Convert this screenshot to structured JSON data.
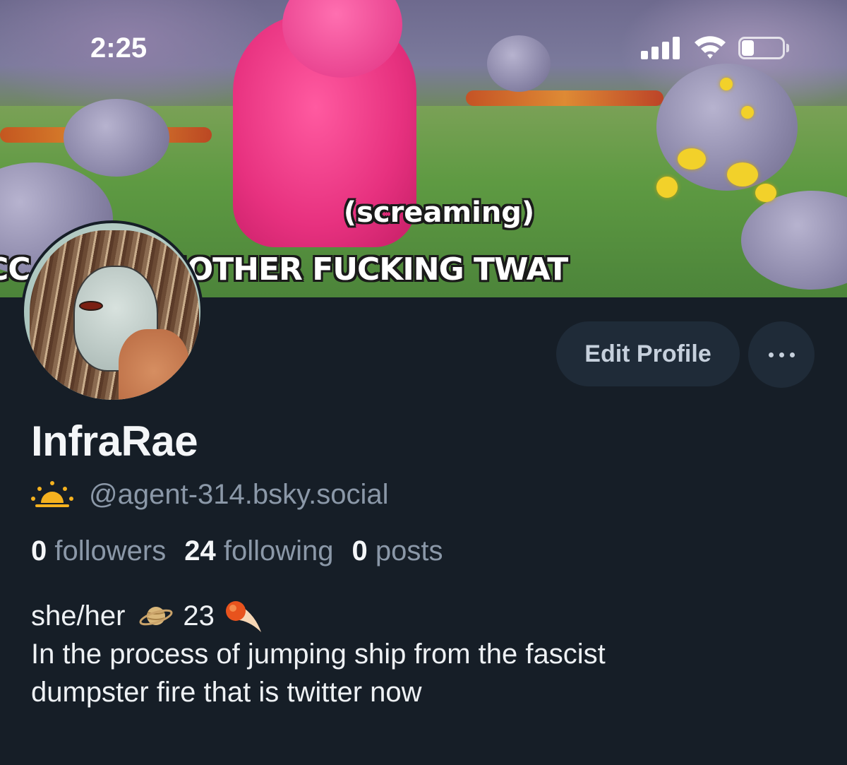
{
  "status_bar": {
    "time": "2:25",
    "icons": [
      "cellular-signal-icon",
      "wifi-icon",
      "battery-icon"
    ],
    "battery_level": 0.3
  },
  "banner": {
    "line1": "(screaming)",
    "line2": "CC    CKING MOTHER FUCKING TWAT"
  },
  "profile": {
    "display_name": "InfraRae",
    "handle": "@agent-314.bsky.social",
    "handle_icon": "sun-icon",
    "stats": [
      {
        "count": "0",
        "label": "followers"
      },
      {
        "count": "24",
        "label": "following"
      },
      {
        "count": "0",
        "label": "posts"
      }
    ],
    "bio_line1_a": "she/her",
    "bio_line1_b": "23",
    "bio_line2": "In the process of jumping ship from the fascist",
    "bio_line3": "dumpster fire that is twitter now"
  },
  "actions": {
    "edit_label": "Edit Profile",
    "more_icon": "ellipsis-icon"
  },
  "colors": {
    "background": "#161e27",
    "button_bg": "#1f2b38",
    "muted_text": "#8b98a8",
    "primary_text": "#f4f6f8"
  }
}
